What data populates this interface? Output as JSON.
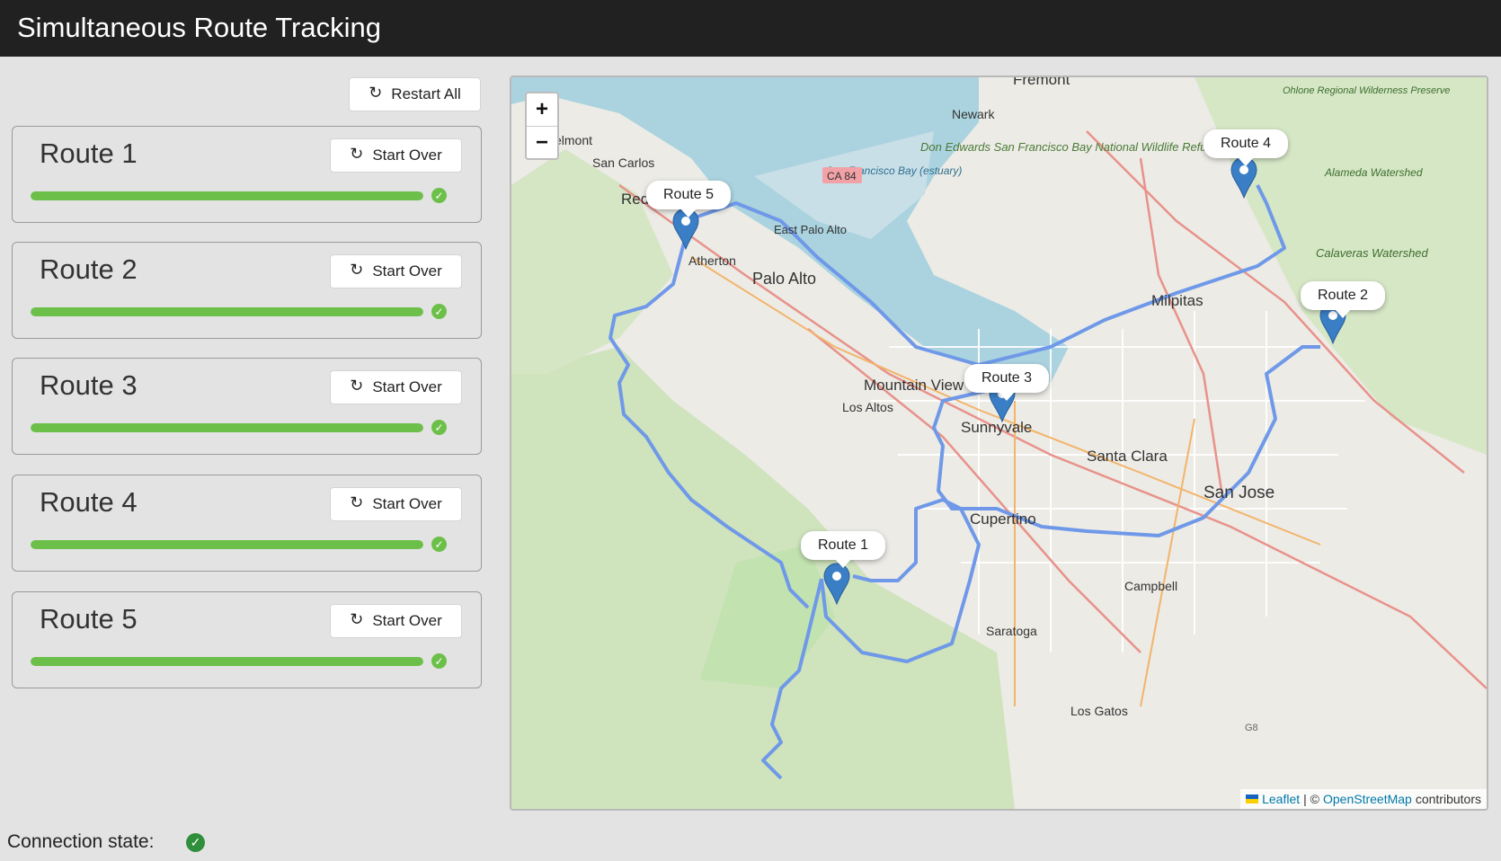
{
  "header": {
    "title": "Simultaneous Route Tracking"
  },
  "controls": {
    "restart_all_label": "Restart All",
    "restart_icon": "refresh-icon"
  },
  "routes": [
    {
      "name": "Route 1",
      "button_label": "Start Over",
      "progress": 1.0,
      "status": "complete"
    },
    {
      "name": "Route 2",
      "button_label": "Start Over",
      "progress": 1.0,
      "status": "complete"
    },
    {
      "name": "Route 3",
      "button_label": "Start Over",
      "progress": 1.0,
      "status": "complete"
    },
    {
      "name": "Route 4",
      "button_label": "Start Over",
      "progress": 1.0,
      "status": "complete"
    },
    {
      "name": "Route 5",
      "button_label": "Start Over",
      "progress": 1.0,
      "status": "complete"
    }
  ],
  "map": {
    "zoom_in": "+",
    "zoom_out": "−",
    "attribution_leaflet": "Leaflet",
    "attribution_sep": "| ©",
    "attribution_osm": "OpenStreetMap",
    "attribution_tail": "contributors",
    "popups": [
      "Route 1",
      "Route 2",
      "Route 3",
      "Route 4",
      "Route 5"
    ],
    "places": {
      "fremont": "Fremont",
      "newark": "Newark",
      "belmont": "elmont",
      "san_carlos": "San Carlos",
      "redwood_city": "Redwood City",
      "atherton": "Atherton",
      "palo_alto": "Palo Alto",
      "east_palo_alto": "East Palo Alto",
      "milpitas": "Milpitas",
      "mountain_view": "Mountain View",
      "los_altos": "Los Altos",
      "sunnyvale": "Sunnyvale",
      "santa_clara": "Santa Clara",
      "san_jose": "San Jose",
      "cupertino": "Cupertino",
      "campbell": "Campbell",
      "saratoga": "Saratoga",
      "los_gatos": "Los Gatos",
      "refuge": "Don Edwards San Francisco Bay National Wildlife Refuge",
      "alameda": "Alameda Watershed",
      "calaveras": "Calaveras Watershed",
      "ohlone": "Ohlone Regional Wilderness Preserve",
      "ca84": "CA 84",
      "bay_estuary": "San Francisco Bay (estuary)",
      "g8": "G8"
    },
    "route_color": "#6f99e8",
    "marker_color": "#3a7ec6"
  },
  "footer": {
    "connection_label": "Connection state:",
    "connection_status": "connected"
  }
}
